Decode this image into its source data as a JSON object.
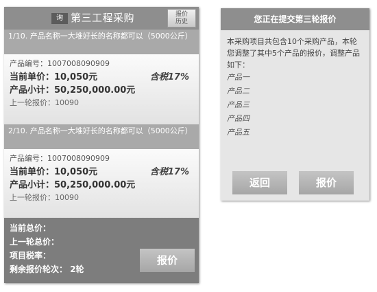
{
  "header": {
    "back_label": "询",
    "title": "第三工程采购",
    "history_line1": "报价",
    "history_line2": "历史"
  },
  "items": [
    {
      "head": "1/10. 产品名称一大堆好长的名称都可以（5000公斤）",
      "code": "产品编号：1007008090909",
      "unit_label": "当前单价：",
      "unit_price": "10,050元",
      "tax": "含税17%",
      "subtotal_label": "产品小计：",
      "subtotal": "50,250,000.00元",
      "prev": "上一轮报价：10090"
    },
    {
      "head": "2/10. 产品名称一大堆好长的名称都可以（5000公斤）",
      "code": "产品编号：1007008090909",
      "unit_label": "当前单价：",
      "unit_price": "10,050元",
      "tax": "含税17%",
      "subtotal_label": "产品小计：",
      "subtotal": "50,250,000.00元",
      "prev": "上一轮报价：10090"
    }
  ],
  "summary": {
    "total_label": "当前总价：",
    "prev_total_label": "上一轮总价：",
    "tax_rate_label": "项目税率：",
    "remaining_label": "剩余报价轮次：",
    "remaining_value": "2轮",
    "submit_label": "报价"
  },
  "dialog": {
    "title": "您正在提交第三轮报价",
    "message": "本采购项目共包含10个采购产品，本轮您调整了其中5个产品的报价，调整产品如下：",
    "products": [
      "产品一",
      "产品二",
      "产品三",
      "产品四",
      "产品五"
    ],
    "back_label": "返回",
    "confirm_label": "报价"
  }
}
